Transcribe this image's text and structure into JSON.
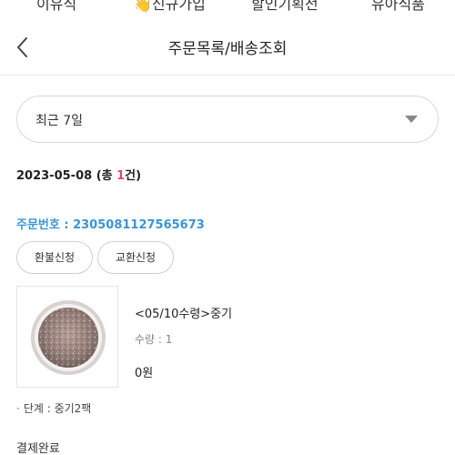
{
  "top_nav": {
    "tabs": [
      "이유식",
      "👋신규가입",
      "할인기획전",
      "유아식품"
    ]
  },
  "header": {
    "title": "주문목록/배송조회"
  },
  "filter": {
    "period_selected": "최근 7일"
  },
  "order_group": {
    "date": "2023-05-08",
    "count_prefix": "(총 ",
    "count": "1",
    "count_suffix": "건)"
  },
  "order": {
    "number_label": "주문번호 : 2305081127565673",
    "refund_button": "환불신청",
    "exchange_button": "교환신청",
    "product": {
      "name": "<05/10수령>중기",
      "quantity": "수량 : 1",
      "price": "0원"
    },
    "option": "단계 : 중기2팩",
    "status": "결제완료"
  },
  "icons": {
    "back": "chevron-left-icon",
    "dropdown": "chevron-down-icon"
  }
}
